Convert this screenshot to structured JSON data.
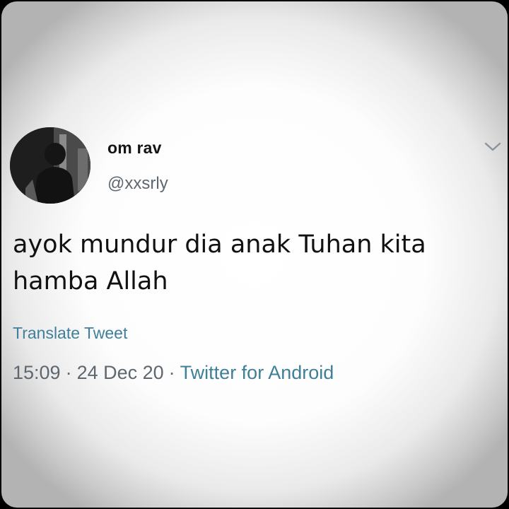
{
  "tweet": {
    "display_name": "om rav",
    "handle": "@xxsrly",
    "text": "ayok mundur dia anak Tuhan kita\nhamba Allah",
    "translate_label": "Translate Tweet",
    "time": "15:09",
    "date": "24 Dec 20",
    "source": "Twitter for Android",
    "separator": "·",
    "menu_icon": "chevron-down-icon",
    "avatar_icon": "avatar"
  },
  "colors": {
    "link": "#3f7f99",
    "muted": "#5e6770",
    "text": "#111111"
  }
}
